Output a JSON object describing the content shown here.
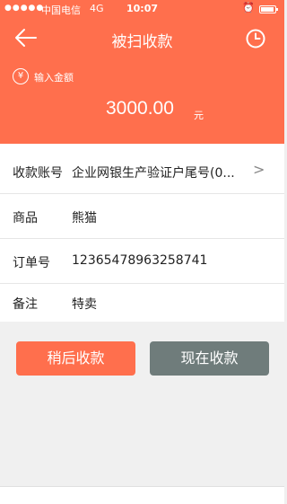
{
  "status_bar": {
    "signal": "●●●●●",
    "carrier": "中国电信",
    "network": "4G",
    "time": "10:07",
    "battery_level": 0.9
  },
  "navbar": {
    "title": "被扫收款",
    "back_icon": "back-arrow-icon",
    "history_icon": "clock-icon"
  },
  "amount": {
    "label": "输入金额",
    "currency_symbol": "¥",
    "value": "3000.00",
    "unit": "元"
  },
  "form": {
    "rows": [
      {
        "label": "收款账号",
        "value": "企业网银生产验证户尾号(0...",
        "has_chevron": true
      },
      {
        "label": "商品",
        "value": "熊猫"
      },
      {
        "label": "订单号",
        "value": "12365478963258741"
      },
      {
        "label": "备注",
        "value": "特卖"
      }
    ],
    "chevron": ">"
  },
  "actions": {
    "later_label": "稍后收款",
    "now_label": "现在收款"
  },
  "colors": {
    "primary": "#ff6f4d",
    "secondary_button": "#6f7c7b"
  }
}
